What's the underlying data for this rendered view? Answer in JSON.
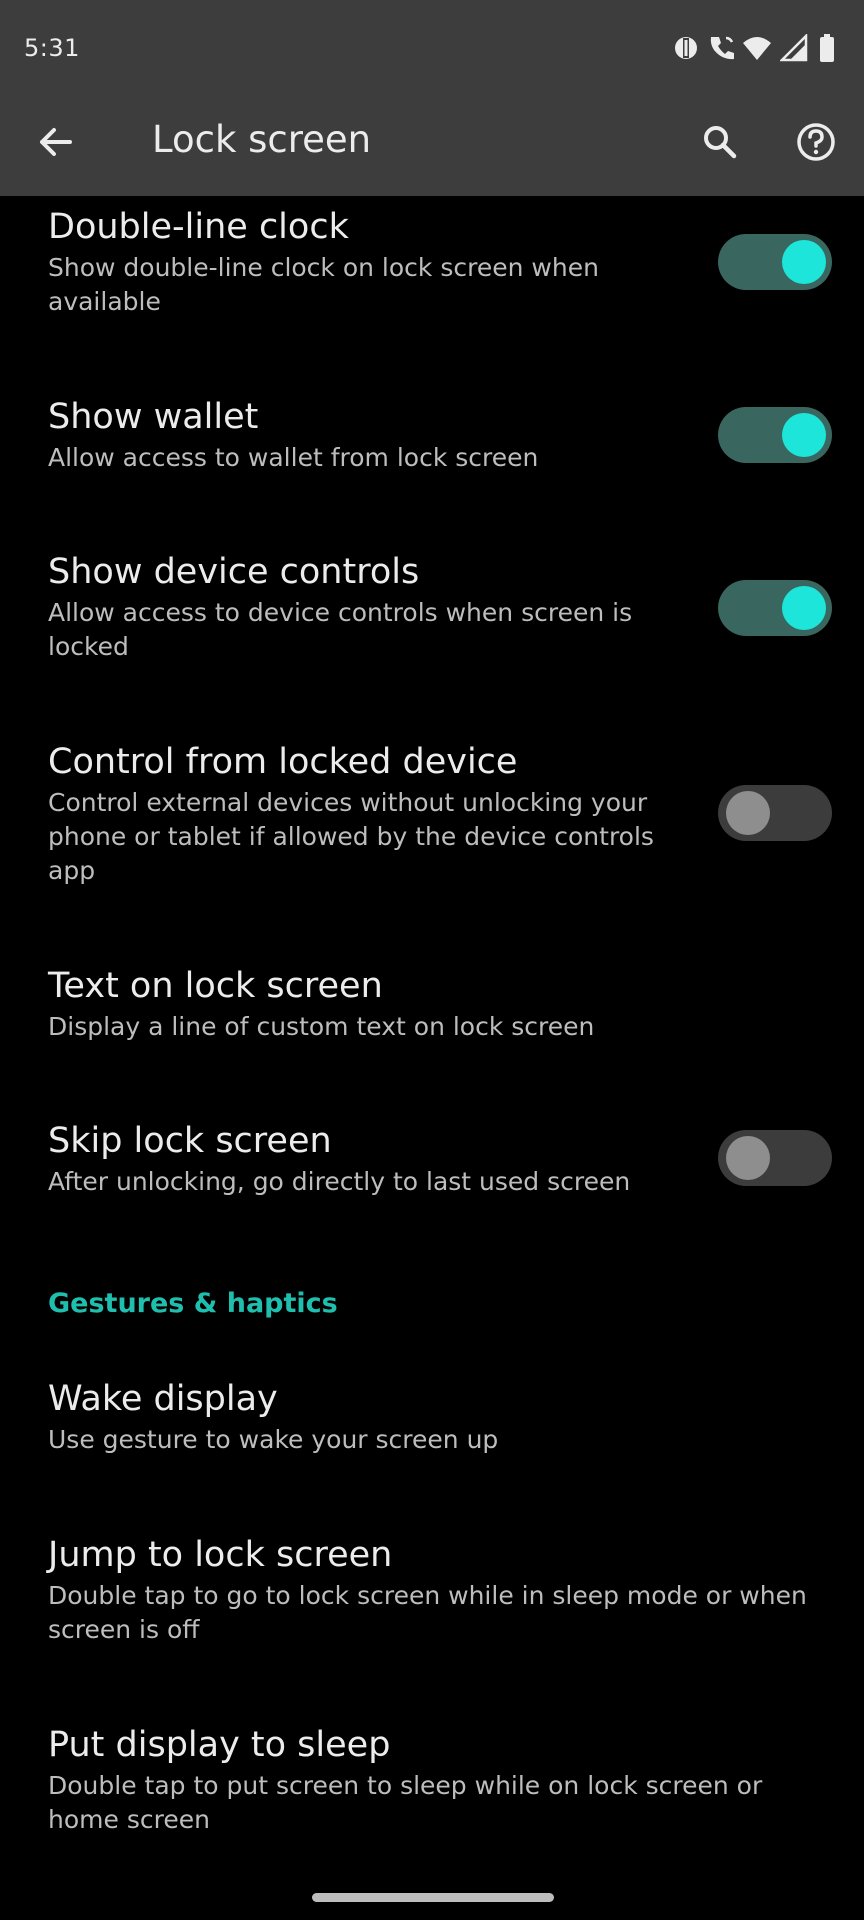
{
  "status_bar": {
    "time": "5:31",
    "icons": [
      "hotspot-icon",
      "wifi-calling-icon",
      "wifi-icon",
      "signal-icon",
      "battery-icon"
    ]
  },
  "toolbar": {
    "title": "Lock screen",
    "back_icon": "arrow-back-icon",
    "search_icon": "search-icon",
    "help_icon": "help-icon"
  },
  "settings": [
    {
      "title": "Double-line clock",
      "summary": "Show double-line clock on lock screen when available",
      "toggle": true
    },
    {
      "title": "Show wallet",
      "summary": "Allow access to wallet from lock screen",
      "toggle": true
    },
    {
      "title": "Show device controls",
      "summary": "Allow access to device controls when screen is locked",
      "toggle": true
    },
    {
      "title": "Control from locked device",
      "summary": "Control external devices without unlocking your phone or tablet if allowed by the device controls app",
      "toggle": false
    },
    {
      "title": "Text on lock screen",
      "summary": "Display a line of custom text on lock screen"
    },
    {
      "title": "Skip lock screen",
      "summary": "After unlocking, go directly to last used screen",
      "toggle": false
    }
  ],
  "section_header": "Gestures & haptics",
  "gestures": [
    {
      "title": "Wake display",
      "summary": "Use gesture to wake your screen up"
    },
    {
      "title": "Jump to lock screen",
      "summary": "Double tap to go to lock screen while in sleep mode or when screen is off"
    },
    {
      "title": "Put display to sleep",
      "summary": "Double tap to put screen to sleep while on lock screen or home screen"
    }
  ],
  "colors": {
    "accent": "#1ee5d9",
    "section_header": "#1fbfb0",
    "app_bar": "#3d3d3d",
    "background": "#000000"
  }
}
